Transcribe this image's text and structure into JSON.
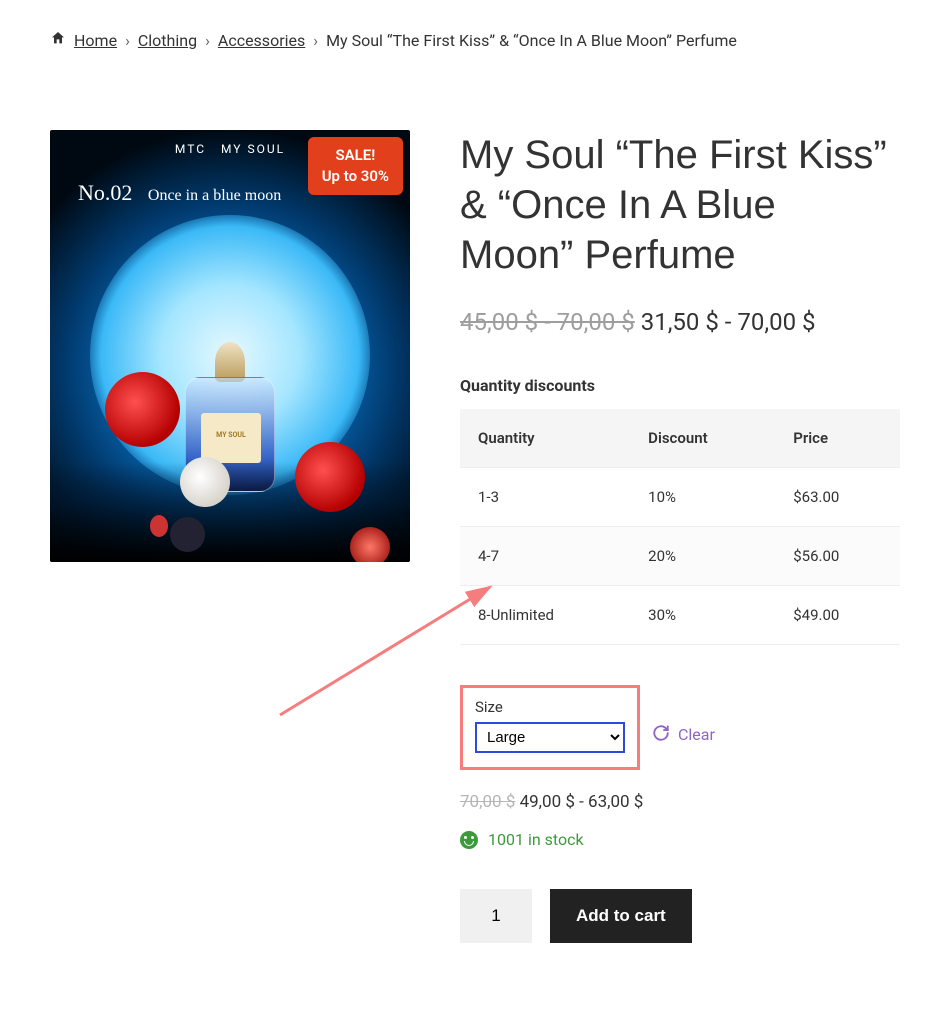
{
  "breadcrumb": {
    "home": "Home",
    "clothing": "Clothing",
    "accessories": "Accessories",
    "current": "My Soul “The First Kiss” & “Once In A Blue Moon” Perfume"
  },
  "sale_badge": {
    "line1": "SALE!",
    "line2": "Up to 30%"
  },
  "image": {
    "brand_row": "MTC   MY SOUL",
    "no_label": "No.02",
    "script": "Once in a blue moon",
    "bottle_label": "MY SOUL"
  },
  "title": "My Soul “The First Kiss” & “Once In A Blue Moon” Perfume",
  "price": {
    "old": "45,00 $ - 70,00 $",
    "new": "31,50 $ - 70,00 $"
  },
  "discounts": {
    "heading": "Quantity discounts",
    "headers": {
      "qty": "Quantity",
      "disc": "Discount",
      "price": "Price"
    },
    "rows": [
      {
        "qty": "1-3",
        "disc": "10%",
        "price": "$63.00"
      },
      {
        "qty": "4-7",
        "disc": "20%",
        "price": "$56.00"
      },
      {
        "qty": "8-Unlimited",
        "disc": "30%",
        "price": "$49.00"
      }
    ]
  },
  "size": {
    "label": "Size",
    "selected": "Large"
  },
  "clear": "Clear",
  "variation_price": {
    "old": "70,00 $",
    "new": "49,00 $ - 63,00 $"
  },
  "stock": "1001 in stock",
  "cart": {
    "qty": "1",
    "button": "Add to cart"
  }
}
